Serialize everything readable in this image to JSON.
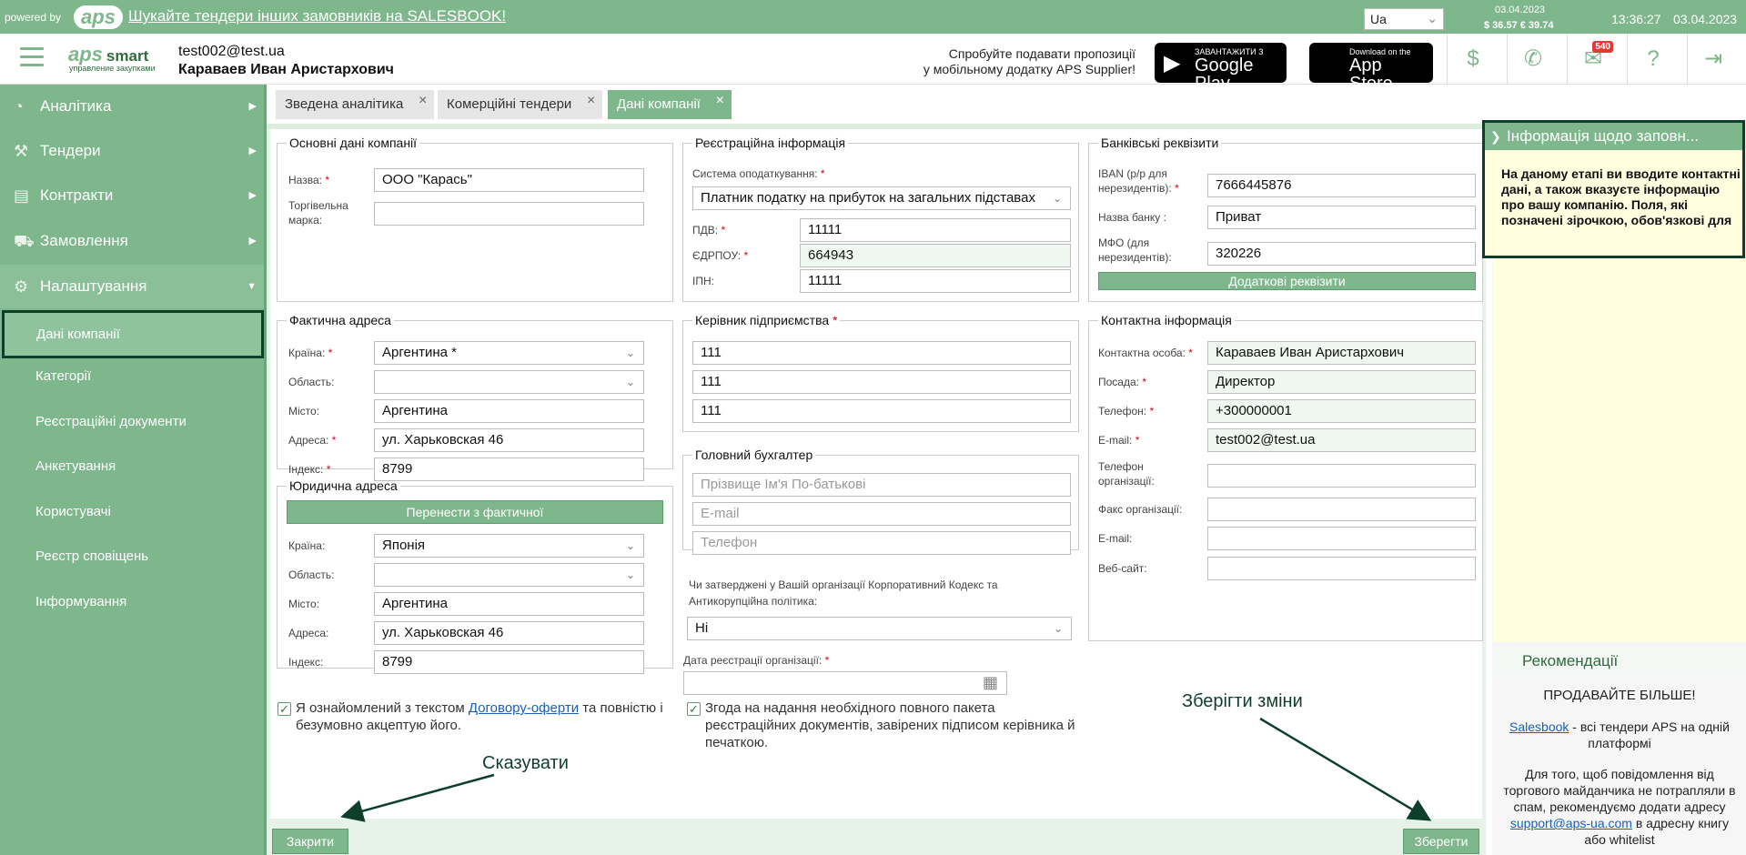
{
  "topbar": {
    "powered_by": "powered by",
    "logo": "aps",
    "promo": "Шукайте тендери інших замовників на SALESBOOK!",
    "language": "Ua",
    "rate_date": "03.04.2023",
    "rates": "$ 36.57  € 39.74",
    "time": "13:36:27",
    "date": "03.04.2023"
  },
  "header": {
    "brand": "aps",
    "brand_suffix": "smart",
    "brand_sub": "управление закупками",
    "user_email": "test002@test.ua",
    "user_name": "Караваев Иван Аристархович",
    "mobile_line1": "Спробуйте подавати пропозиції",
    "mobile_line2": "у мобільному додатку APS Supplier!",
    "gplay_small": "ЗАВАНТАЖИТИ З",
    "gplay_big": "Google Play",
    "appstore_small": "Download on the",
    "appstore_big": "App Store",
    "mail_badge": "540"
  },
  "sidebar": {
    "items": [
      {
        "label": "Аналітика"
      },
      {
        "label": "Тендери"
      },
      {
        "label": "Контракти"
      },
      {
        "label": "Замовлення"
      },
      {
        "label": "Налаштування"
      }
    ],
    "subitems": [
      {
        "label": "Дані компанії"
      },
      {
        "label": "Категорії"
      },
      {
        "label": "Реєстраційні документи"
      },
      {
        "label": "Анкетування"
      },
      {
        "label": "Користувачі"
      },
      {
        "label": "Реєстр сповіщень"
      },
      {
        "label": "Інформування"
      }
    ]
  },
  "tabs": [
    {
      "label": "Зведена аналітика"
    },
    {
      "label": "Комерційні тендери"
    },
    {
      "label": "Дані компанії"
    }
  ],
  "basic": {
    "legend": "Основні дані компанії",
    "name_label": "Назва:",
    "name_value": "ООО \"Карась\"",
    "brand_label": "Торгівельна марка:",
    "brand_value": ""
  },
  "registration": {
    "legend": "Реєстраційна інформація",
    "tax_label": "Система оподаткування:",
    "tax_value": "Платник податку на прибуток на загальних підставах",
    "vat_label": "ПДВ:",
    "vat_value": "11111",
    "edrpou_label": "ЄДРПОУ:",
    "edrpou_value": "664943",
    "ipn_label": "ІПН:",
    "ipn_value": "11111"
  },
  "bank": {
    "legend": "Банківські реквізити",
    "iban_label": "IBAN (р/р для нерезидентів):",
    "iban_value": "7666445876",
    "bank_label": "Назва банку :",
    "bank_value": "Приват",
    "mfo_label": "МФО (для нерезидентів):",
    "mfo_value": "320226",
    "extra_button": "Додаткові реквізити"
  },
  "actual_address": {
    "legend": "Фактична адреса",
    "country_label": "Країна:",
    "country_value": "Аргентина *",
    "region_label": "Область:",
    "region_value": "",
    "city_label": "Місто:",
    "city_value": "Аргентина",
    "address_label": "Адреса:",
    "address_value": "ул. Харьковская 46",
    "index_label": "Індекс:",
    "index_value": "8799"
  },
  "legal_address": {
    "legend": "Юридична адреса",
    "copy_button": "Перенести з фактичної",
    "country_label": "Країна:",
    "country_value": "Японія",
    "region_label": "Область:",
    "region_value": "",
    "city_label": "Місто:",
    "city_value": "Аргентина",
    "address_label": "Адреса:",
    "address_value": "ул. Харьковская 46",
    "index_label": "Індекс:",
    "index_value": "8799"
  },
  "director": {
    "legend": "Керівник підприємства",
    "f1": "111",
    "f2": "111",
    "f3": "111"
  },
  "accountant": {
    "legend": "Головний бухгалтер",
    "name_ph": "Прізвище Ім'я По-батькові",
    "email_ph": "E-mail",
    "phone_ph": "Телефон"
  },
  "corporate": {
    "question": "Чи затверджені у Вашій організації Корпоративний Кодекс та Антикорупційна політика:",
    "answer": "Ні",
    "reg_date_label": "Дата реєстрації організації:",
    "reg_date_value": ""
  },
  "contact": {
    "legend": "Контактна інформація",
    "person_label": "Контактна особа:",
    "person_value": "Караваев Иван Аристархович",
    "position_label": "Посада:",
    "position_value": "Директор",
    "phone_label": "Телефон:",
    "phone_value": "+300000001",
    "email_label": "E-mail:",
    "email_value": "test002@test.ua",
    "org_phone_label": "Телефон організації:",
    "org_phone_value": "",
    "fax_label": "Факс організації:",
    "fax_value": "",
    "org_email_label": "E-mail:",
    "org_email_value": "",
    "site_label": "Веб-сайт:",
    "site_value": ""
  },
  "agreements": {
    "offer_before": "Я ознайомлений з текстом ",
    "offer_link": "Договору-оферти",
    "offer_after": " та повністю і безумовно акцептую його.",
    "consent": "Згода на надання необхідного повного пакета реєстраційних документів, завірених підписом керівника й печаткою."
  },
  "annotations": {
    "cancel": "Сказувати",
    "save": "Зберігти зміни"
  },
  "buttons": {
    "close": "Закрити",
    "save": "Зберегти"
  },
  "info_panel": {
    "title": "Інформація щодо заповн...",
    "body": "На даному етапі ви вводите контактні дані, а також вказуєте інформацію про вашу компанію. Поля, які позначені зірочкою, обов'язкові для заповнення"
  },
  "recommendations": {
    "title": "Рекомендації",
    "headline": "ПРОДАВАЙТЕ БІЛЬШЕ!",
    "link1": "Salesbook",
    "text1": " - всі тендери APS на одній платформі",
    "text2": "Для того, щоб повідомлення від торгового майданчика не потрапляли в спам, рекомендуємо додати адресу ",
    "link2": "support@aps-ua.com",
    "text3": " в адресну книгу або whitelist"
  },
  "colors": {
    "accent": "#7fb78d",
    "dark_frame": "#0d3f2a",
    "info_bg": "#ffffe0"
  }
}
